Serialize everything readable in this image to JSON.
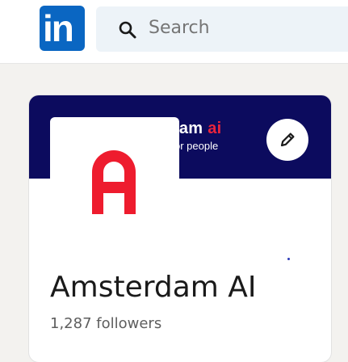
{
  "nav": {
    "logo_text": "in",
    "search": {
      "placeholder": "Search",
      "icon": "search-icon"
    }
  },
  "company": {
    "banner": {
      "brand_partial": "lam",
      "brand_accent": "ai",
      "tagline_partial": "or people"
    },
    "edit_icon": "pencil-icon",
    "logo_letter": "A",
    "name": "Amsterdam AI",
    "followers": "1,287 followers"
  },
  "colors": {
    "linkedin_blue": "#0a66c2",
    "banner_navy": "#0c0b5e",
    "brand_red": "#e8243c"
  }
}
